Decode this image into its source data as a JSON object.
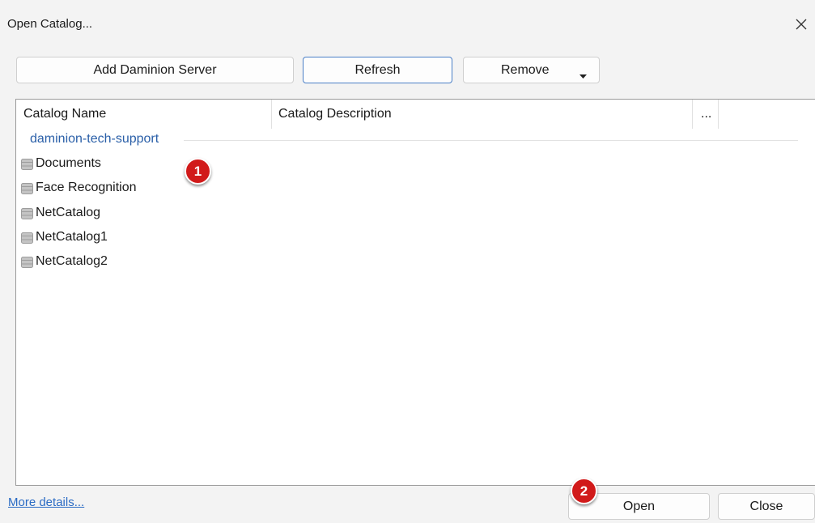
{
  "window": {
    "title": "Open Catalog..."
  },
  "toolbar": {
    "add_label": "Add Daminion Server",
    "refresh_label": "Refresh",
    "remove_label": "Remove"
  },
  "list": {
    "columns": [
      "Catalog Name",
      "Catalog Description",
      "..."
    ],
    "group": "daminion-tech-support",
    "items": [
      "Documents",
      "Face Recognition",
      "NetCatalog",
      "NetCatalog1",
      "NetCatalog2"
    ]
  },
  "badges": [
    "1",
    "2"
  ],
  "footer": {
    "more_details": "More details...",
    "open_label": "Open",
    "close_label": "Close"
  },
  "colors": {
    "accent": "#4a7fc7",
    "link": "#2a6bc4",
    "badge": "#d11a1a"
  }
}
